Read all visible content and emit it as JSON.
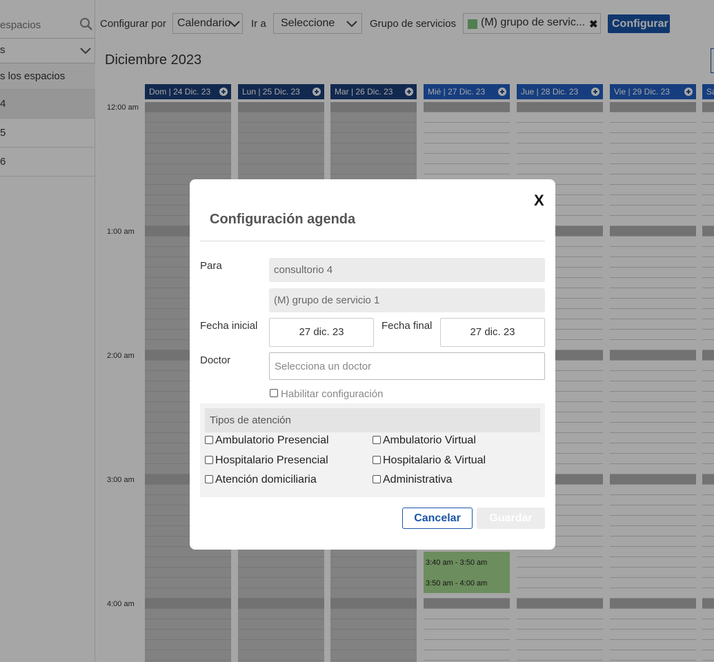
{
  "sidebar": {
    "search_placeholder": "espacios",
    "select_label": "s",
    "all_spaces": "s los espacios",
    "items": [
      {
        "label": "4",
        "selected": true
      },
      {
        "label": "5",
        "selected": false
      },
      {
        "label": "6",
        "selected": false
      }
    ]
  },
  "toolbar": {
    "configure_by_label": "Configurar por",
    "configure_by_value": "Calendario",
    "goto_label": "Ir a",
    "goto_value": "Seleccione",
    "group_label": "Grupo de servicios",
    "group_tag": "(M) grupo de servic...",
    "group_remove": "✖",
    "configure_button": "Configurar"
  },
  "calendar": {
    "month": "Diciembre 2023",
    "days": [
      {
        "label": "Dom | 24 Dic. 23",
        "state": "past"
      },
      {
        "label": "Lun | 25 Dic. 23",
        "state": "past"
      },
      {
        "label": "Mar | 26 Dic. 23",
        "state": "past"
      },
      {
        "label": "Mié | 27 Dic. 23",
        "state": "future"
      },
      {
        "label": "Jue | 28 Dic. 23",
        "state": "future"
      },
      {
        "label": "Vie | 29 Dic. 23",
        "state": "future"
      },
      {
        "label": "Sá",
        "state": "future"
      }
    ],
    "hours": [
      "12:00 am",
      "1:00 am",
      "2:00 am",
      "3:00 am",
      "4:00 am"
    ],
    "slots": [
      "3:40 am - 3:50 am",
      "3:50 am - 4:00 am"
    ]
  },
  "modal": {
    "title": "Configuración agenda",
    "close": "X",
    "para_label": "Para",
    "para_value": "consultorio 4",
    "group_value": "(M) grupo de servicio 1",
    "fecha_inicial_label": "Fecha inicial",
    "fecha_inicial_value": "27 dic. 23",
    "fecha_final_label": "Fecha final",
    "fecha_final_value": "27 dic. 23",
    "doctor_label": "Doctor",
    "doctor_placeholder": "Selecciona un doctor",
    "habilitar_label": "Habilitar configuración",
    "tipos_header": "Tipos de atención",
    "tipos": [
      "Ambulatorio Presencial",
      "Ambulatorio Virtual",
      "Hospitalario Presencial",
      "Hospitalario & Virtual",
      "Atención domiciliaria",
      "Administrativa"
    ],
    "cancel_button": "Cancelar",
    "save_button": "Guardar"
  },
  "colors": {
    "primary": "#1a55a8",
    "header_past": "#1c3f7a",
    "header_future": "#2360c4",
    "slot_green": "#a6d98f",
    "tag_green": "#7dc47d"
  }
}
